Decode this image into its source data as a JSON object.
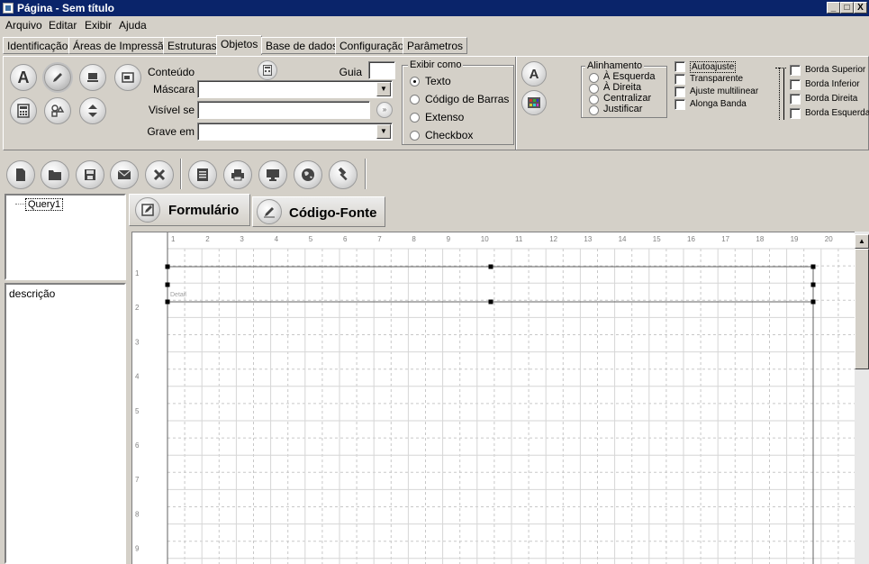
{
  "window": {
    "title": "Página - Sem título",
    "minimize": "_",
    "maximize": "□",
    "close": "X"
  },
  "menu": [
    "Arquivo",
    "Editar",
    "Exibir",
    "Ajuda"
  ],
  "tabs": [
    "Identificação",
    "Áreas de Impressão",
    "Estruturas",
    "Objetos",
    "Base de dados",
    "Configuração",
    "Parâmetros"
  ],
  "active_tab": "Objetos",
  "props": {
    "conteudo_label": "Conteúdo",
    "guia_label": "Guia",
    "guia_value": "",
    "mascara_label": "Máscara",
    "mascara_value": "",
    "visivel_label": "Visível se",
    "visivel_value": "",
    "grave_label": "Grave em",
    "grave_value": "",
    "exibir_como": {
      "title": "Exibir como",
      "options": [
        "Texto",
        "Código de Barras",
        "Extenso",
        "Checkbox"
      ],
      "selected": "Texto"
    },
    "alinhamento": {
      "title": "Alinhamento",
      "options": [
        "À Esquerda",
        "À Direita",
        "Centralizar",
        "Justificar"
      ]
    },
    "flags": [
      "Autoajuste",
      "Transparente",
      "Ajuste multilinear",
      "Alonga Banda"
    ],
    "bordas": [
      "Borda Superior",
      "Borda Inferior",
      "Borda Direita",
      "Borda Esquerda"
    ]
  },
  "object_tools": [
    "text-tool-icon",
    "edit-tool-icon",
    "computer-tool-icon",
    "image-tool-icon",
    "calculator-tool-icon",
    "shapes-tool-icon",
    "updown-tool-icon"
  ],
  "toolbar_icons": [
    "new-file-icon",
    "open-folder-icon",
    "save-icon",
    "email-icon",
    "delete-icon",
    "print-preview-icon",
    "printer-icon",
    "monitor-icon",
    "globe-icon",
    "hammer-icon"
  ],
  "tree": {
    "root": "Query1"
  },
  "description_label": "descrição",
  "designer_tabs": [
    "Formulário",
    "Código-Fonte"
  ],
  "ruler": [
    "1",
    "2",
    "3",
    "4",
    "5",
    "6",
    "7",
    "8",
    "9",
    "10",
    "11",
    "12",
    "13",
    "14",
    "15",
    "16",
    "17",
    "18",
    "19",
    "20"
  ],
  "vruler": [
    "1",
    "2",
    "3",
    "4",
    "5",
    "6",
    "7",
    "8",
    "9"
  ],
  "band_label": "Detail"
}
